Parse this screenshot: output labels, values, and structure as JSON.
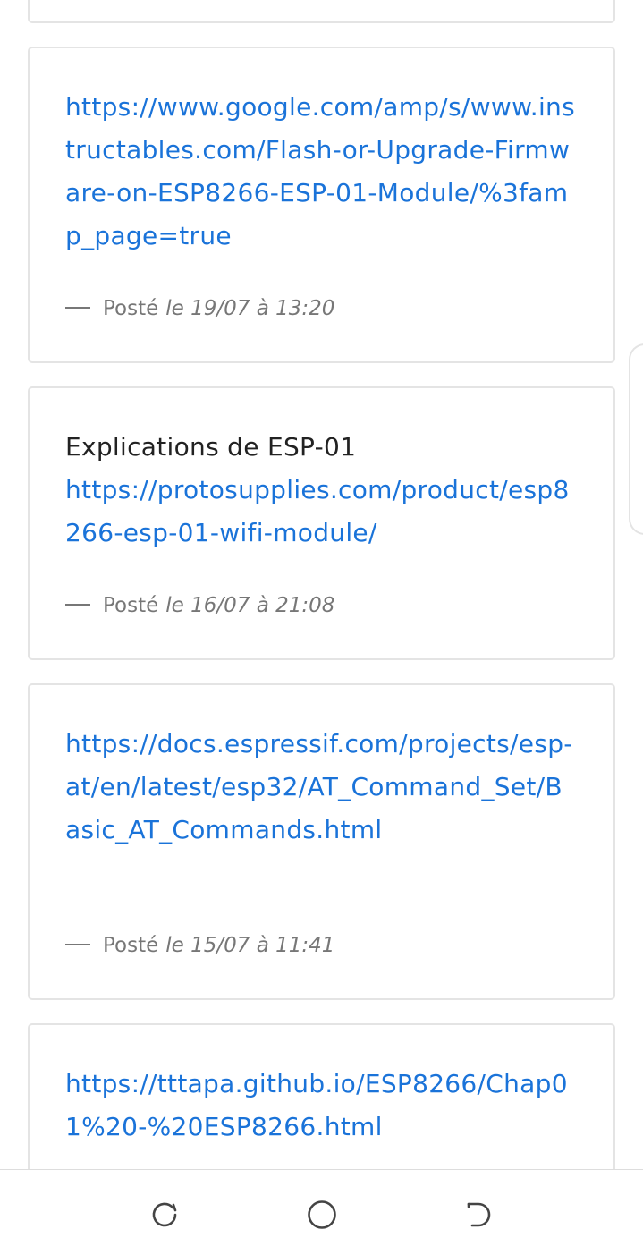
{
  "posts": [
    {
      "text": "",
      "link": "https://www.google.com/amp/s/www.instructables.com/Flash-or-Upgrade-Firmware-on-ESP8266-ESP-01-Module/%3famp_page=true",
      "posted_label": "Posté",
      "date": "le 19/07 à 13:20"
    },
    {
      "text": "Explications de ESP-01",
      "link": "https://protosupplies.com/product/esp8266-esp-01-wifi-module/",
      "posted_label": "Posté",
      "date": "le 16/07 à 21:08"
    },
    {
      "text": "",
      "link": "https://docs.espressif.com/projects/esp-at/en/latest/esp32/AT_Command_Set/Basic_AT_Commands.html",
      "posted_label": "Posté",
      "date": "le 15/07 à 11:41"
    },
    {
      "text": "",
      "link": "https://tttapa.github.io/ESP8266/Chap01%20-%20ESP8266.html"
    }
  ],
  "navbar": {
    "recent_icon": "recent-apps-icon",
    "home_icon": "home-icon",
    "back_icon": "back-icon"
  },
  "colors": {
    "link": "#1a73d9",
    "text": "#222222",
    "meta": "#777777",
    "border": "#e4e4e4"
  }
}
